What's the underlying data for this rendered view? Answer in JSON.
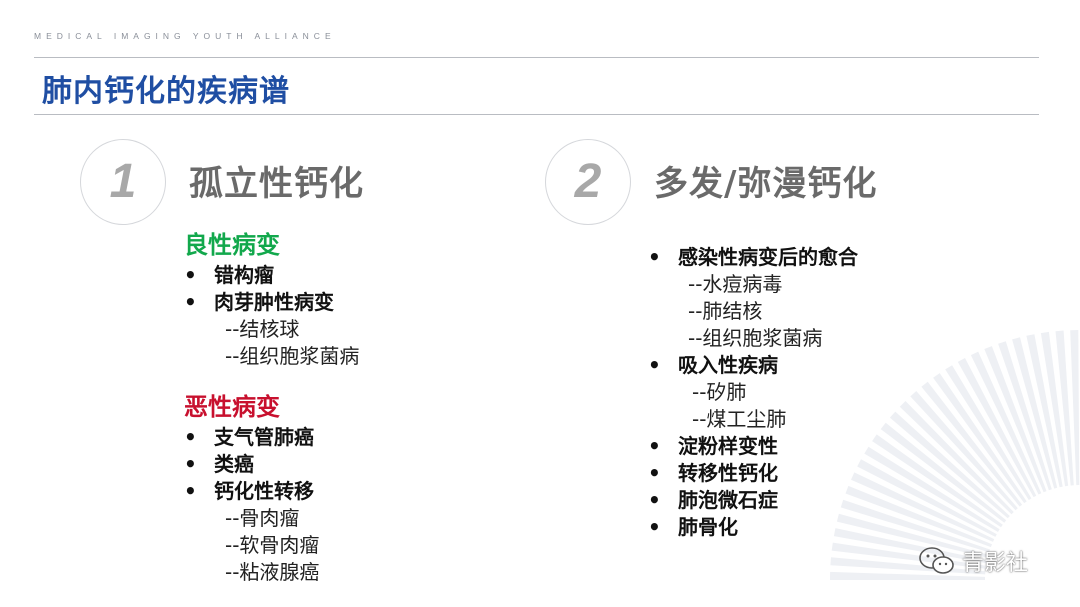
{
  "header": {
    "org": "MEDICAL IMAGING YOUTH ALLIANCE",
    "title": "肺内钙化的疾病谱"
  },
  "section1": {
    "number": "1",
    "title": "孤立性钙化",
    "benign": {
      "label": "良性病变",
      "items": [
        "错构瘤",
        "肉芽肿性病变"
      ],
      "subitems": [
        "--结核球",
        "--组织胞浆菌病"
      ]
    },
    "malignant": {
      "label": "恶性病变",
      "items": [
        "支气管肺癌",
        "类癌",
        "钙化性转移"
      ],
      "subitems": [
        "--骨肉瘤",
        "--软骨肉瘤",
        "--粘液腺癌"
      ]
    }
  },
  "section2": {
    "number": "2",
    "title": "多发/弥漫钙化",
    "groups": [
      {
        "item": "感染性病变后的愈合",
        "subitems": [
          "--水痘病毒",
          "--肺结核",
          "--组织胞浆菌病"
        ]
      },
      {
        "item": "吸入性疾病",
        "subitems": [
          "--矽肺",
          "--煤工尘肺"
        ]
      },
      {
        "item": "淀粉样变性",
        "subitems": []
      },
      {
        "item": "转移性钙化",
        "subitems": []
      },
      {
        "item": "肺泡微石症",
        "subitems": []
      },
      {
        "item": "肺骨化",
        "subitems": []
      }
    ]
  },
  "watermark": {
    "text": "青影社",
    "icon": "wechat-icon"
  },
  "colors": {
    "title": "#1f4ea3",
    "benign": "#12a84c",
    "malignant": "#c8102e",
    "section_title": "#6a6a6a"
  }
}
